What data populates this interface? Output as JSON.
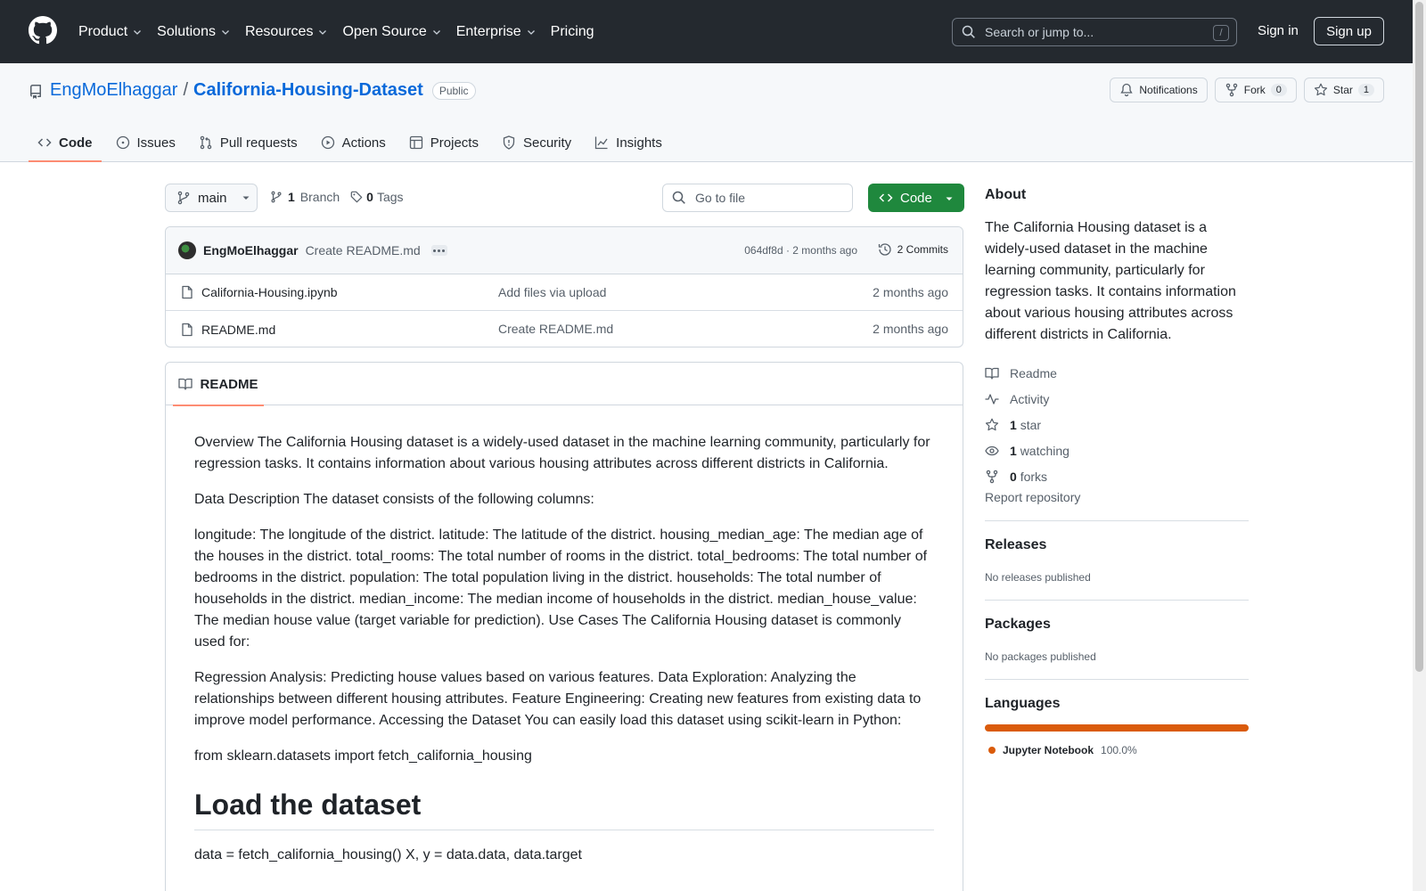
{
  "header": {
    "nav": [
      {
        "label": "Product",
        "has_menu": true
      },
      {
        "label": "Solutions",
        "has_menu": true
      },
      {
        "label": "Resources",
        "has_menu": true
      },
      {
        "label": "Open Source",
        "has_menu": true
      },
      {
        "label": "Enterprise",
        "has_menu": true
      },
      {
        "label": "Pricing",
        "has_menu": false
      }
    ],
    "search_placeholder": "Search or jump to...",
    "search_shortcut": "/",
    "sign_in": "Sign in",
    "sign_up": "Sign up"
  },
  "repo": {
    "owner": "EngMoElhaggar",
    "separator": "/",
    "name": "California-Housing-Dataset",
    "visibility": "Public",
    "notifications_label": "Notifications",
    "fork_label": "Fork",
    "fork_count": "0",
    "star_label": "Star",
    "star_count": "1",
    "tabs": [
      {
        "label": "Code",
        "icon": "code-icon",
        "selected": true
      },
      {
        "label": "Issues",
        "icon": "issue-icon",
        "selected": false
      },
      {
        "label": "Pull requests",
        "icon": "pull-request-icon",
        "selected": false
      },
      {
        "label": "Actions",
        "icon": "play-icon",
        "selected": false
      },
      {
        "label": "Projects",
        "icon": "table-icon",
        "selected": false
      },
      {
        "label": "Security",
        "icon": "shield-icon",
        "selected": false
      },
      {
        "label": "Insights",
        "icon": "graph-icon",
        "selected": false
      }
    ]
  },
  "files": {
    "branch": "main",
    "branch_count": "1",
    "branch_label": "Branch",
    "tag_count": "0",
    "tag_label": "Tags",
    "goto_placeholder": "Go to file",
    "code_button": "Code",
    "latest_commit": {
      "author": "EngMoElhaggar",
      "message": "Create README.md",
      "hash_time": "064df8d · 2 months ago",
      "commits": "2 Commits"
    },
    "rows": [
      {
        "name": "California-Housing.ipynb",
        "message": "Add files via upload",
        "date": "2 months ago"
      },
      {
        "name": "README.md",
        "message": "Create README.md",
        "date": "2 months ago"
      }
    ]
  },
  "readme": {
    "tab_label": "README",
    "paragraphs": [
      "Overview The California Housing dataset is a widely-used dataset in the machine learning community, particularly for regression tasks. It contains information about various housing attributes across different districts in California.",
      "Data Description The dataset consists of the following columns:",
      "longitude: The longitude of the district. latitude: The latitude of the district. housing_median_age: The median age of the houses in the district. total_rooms: The total number of rooms in the district. total_bedrooms: The total number of bedrooms in the district. population: The total population living in the district. households: The total number of households in the district. median_income: The median income of households in the district. median_house_value: The median house value (target variable for prediction). Use Cases The California Housing dataset is commonly used for:",
      "Regression Analysis: Predicting house values based on various features. Data Exploration: Analyzing the relationships between different housing attributes. Feature Engineering: Creating new features from existing data to improve model performance. Accessing the Dataset You can easily load this dataset using scikit-learn in Python:",
      "from sklearn.datasets import fetch_california_housing"
    ],
    "heading": "Load the dataset",
    "after_heading": "data = fetch_california_housing() X, y = data.data, data.target"
  },
  "sidebar": {
    "about_title": "About",
    "about_text": "The California Housing dataset is a widely-used dataset in the machine learning community, particularly for regression tasks. It contains information about various housing attributes across different districts in California.",
    "links": {
      "readme": "Readme",
      "activity": "Activity",
      "stars_count": "1",
      "stars_label": "star",
      "watching_count": "1",
      "watching_label": "watching",
      "forks_count": "0",
      "forks_label": "forks",
      "report": "Report repository"
    },
    "releases_title": "Releases",
    "releases_text": "No releases published",
    "packages_title": "Packages",
    "packages_text": "No packages published",
    "languages_title": "Languages",
    "language_name": "Jupyter Notebook",
    "language_pct": "100.0%",
    "language_color": "#da5b0b"
  }
}
